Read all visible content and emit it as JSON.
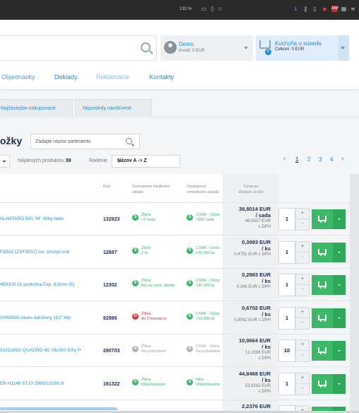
{
  "browser": {
    "zoom": "133 %",
    "icons": [
      "reader-icon",
      "shield-icon",
      "star-icon",
      "download-icon",
      "library-icon",
      "sidebar-icon",
      "pdf-icon",
      "adblock-icon",
      "extension-icon",
      "menu-icon"
    ]
  },
  "header": {
    "search_placeholder": "",
    "user": {
      "name": "Demo",
      "credit": "Kredit: 0 EUR"
    },
    "cart": {
      "name": "Kuchyňa u suseda",
      "total": "Celkom: 0 EUR",
      "count": "0"
    },
    "nav": [
      "Objednávky",
      "Doklady",
      "Reklamácie",
      "Kontakty"
    ]
  },
  "tabs": [
    "Najčastejšie nakupované",
    "Naposledy navštívené"
  ],
  "catalog": {
    "title": "ožky",
    "filter_placeholder": "Zadajte názov sortimentu",
    "found_label": "Nájdených produktov",
    "found_count": "39",
    "sort_label": "Radenie",
    "sort_value": "Názov A -> Z",
    "pages": [
      "1",
      "2",
      "3",
      "4"
    ],
    "prev": "‹",
    "next": "›"
  },
  "table": {
    "headers": {
      "code": "Kód",
      "local_stock": [
        "Dostupnosť lokálneho",
        "skladu"
      ],
      "central_stock": [
        "Dostupnosť",
        "centrálneho skladu"
      ],
      "price": [
        "Cena po",
        "zľavách za MJ"
      ]
    },
    "rows": [
      {
        "name": "ťa ANTARO 500 \"M\" 30kg biela",
        "code": "132923",
        "local": {
          "status": "green",
          "l1": "Žltina",
          "l2": ">5 sada"
        },
        "central": {
          "status": "green",
          "l1": "CSNK - Ostra",
          "l2": ">500 sada"
        },
        "price": [
          "38,8014 EUR",
          "/ sada"
        ],
        "price_vat": [
          "46,5617 EUR",
          "s DPH"
        ],
        "qty": "1"
      },
      {
        "name": "F35A2 (ZSF3502) čer. prichyt vrut",
        "code": "12687",
        "local": {
          "status": "green",
          "l1": "Žltina",
          "l2": "2 ks"
        },
        "central": {
          "status": "green",
          "l1": "CSNK - Ostra",
          "l2": ">20.000 ks"
        },
        "price": [
          "0,3993 EUR",
          "/ ks"
        ],
        "price_vat": [
          "0,4791 EUR s DPH"
        ],
        "qty": "1"
      },
      {
        "name": "4E6100.01 podložka Exp. 8,5mm (5)",
        "code": "12302",
        "local": {
          "status": "green",
          "l1": "Žltina",
          "l2": "iba na centr. sklade"
        },
        "central": {
          "status": "green",
          "l1": "CSNK - Ostra",
          "l2": ">30.000 ks"
        },
        "price": [
          "0,2883 EUR",
          "/ ks"
        ],
        "price_vat": [
          "0,346 EUR s DPH"
        ],
        "qty": "1"
      },
      {
        "name": "SH50500 záves naložený 110° klip",
        "code": "92986",
        "local": {
          "status": "red",
          "l1": "Žltina",
          "l2": "do 2 mesiacov"
        },
        "central": {
          "status": "green",
          "l1": "CSNK - Ostra",
          "l2": ">10.000 ks"
        },
        "price": [
          "0,6702 EUR",
          "/ ks"
        ],
        "price_vat": [
          "0,8042 EUR s DPH"
        ],
        "qty": "1"
      },
      {
        "name": "9181189/2 QUADRO 4D V6/300 SiSy P",
        "code": "290703",
        "local": {
          "status": "grey",
          "l1": "Žltina",
          "l2": "Na požiadanie"
        },
        "central": {
          "status": "grey",
          "l1": "CSNK - Ostra",
          "l2": "Na požiadanie"
        },
        "price": [
          "10,9664 EUR",
          "/ ks"
        ],
        "price_vat": [
          "13,1596 EUR",
          "s DPH"
        ],
        "qty": "10"
      },
      {
        "name": "ER H1146 ST10 2800/1310/0,8",
        "code": "181322",
        "local": {
          "status": "green",
          "l1": "Žltina",
          "l2": "Objednávame"
        },
        "central": {
          "status": "green",
          "l1": "Nitra",
          "l2": "Objednávame"
        },
        "price": [
          "44,8468 EUR",
          "/ ks"
        ],
        "price_vat": [
          "53,8162 EUR",
          "s DPH"
        ],
        "qty": "1"
      },
      {
        "name": "",
        "code": "",
        "local": {
          "status": "",
          "l1": "",
          "l2": ""
        },
        "central": {
          "status": "",
          "l1": "",
          "l2": ""
        },
        "price": [
          "2,2376 EUR"
        ],
        "price_vat": [],
        "qty": "1"
      }
    ]
  },
  "colors": {
    "accent": "#1f8fd6",
    "green": "#36b86a",
    "red": "#d6323a",
    "navy": "#1b2e52"
  }
}
